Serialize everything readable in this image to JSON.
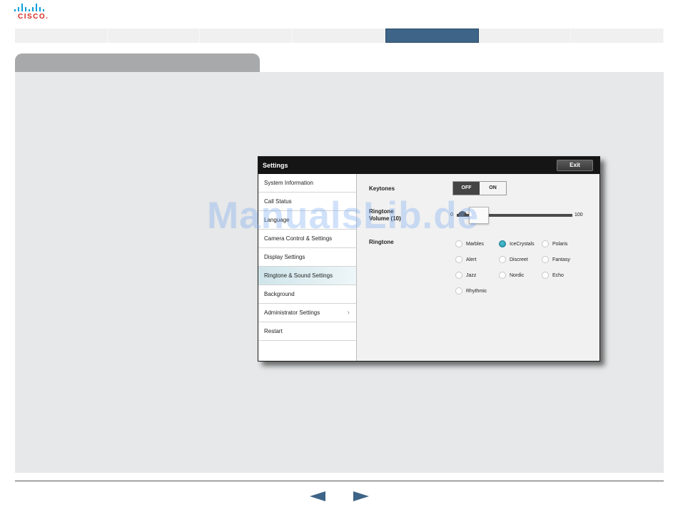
{
  "logo": {
    "text": "CISCO",
    "dot": "."
  },
  "colors": {
    "accent": "#3e6487",
    "selected_radio": "#1d8da4",
    "selected_menu": "#cfe5ea"
  },
  "settings": {
    "title": "Settings",
    "exit_label": "Exit",
    "menu": [
      {
        "label": "System Information"
      },
      {
        "label": "Call Status"
      },
      {
        "label": "Language"
      },
      {
        "label": "Camera Control & Settings"
      },
      {
        "label": "Display Settings"
      },
      {
        "label": "Ringtone & Sound Settings",
        "selected": true
      },
      {
        "label": "Background"
      },
      {
        "label": "Administrator Settings",
        "chevron": "›"
      },
      {
        "label": "Restart"
      },
      {
        "label": ""
      }
    ],
    "keytones": {
      "label": "Keytones",
      "off": "OFF",
      "on": "ON",
      "value": "OFF"
    },
    "volume": {
      "label_line1": "Ringtone",
      "label_line2": "Volume (10)",
      "min": "0",
      "max": "100",
      "value": 10
    },
    "ringtone": {
      "label": "Ringtone",
      "options": [
        "Marbles",
        "IceCrystals",
        "Polaris",
        "Alert",
        "Discreet",
        "Fantasy",
        "Jazz",
        "Nordic",
        "Echo",
        "Rhythmic"
      ],
      "selected": "IceCrystals"
    }
  },
  "watermark": "ManualsLib.de",
  "nav": {
    "prev_icon": "triangle-left",
    "next_icon": "triangle-right"
  }
}
